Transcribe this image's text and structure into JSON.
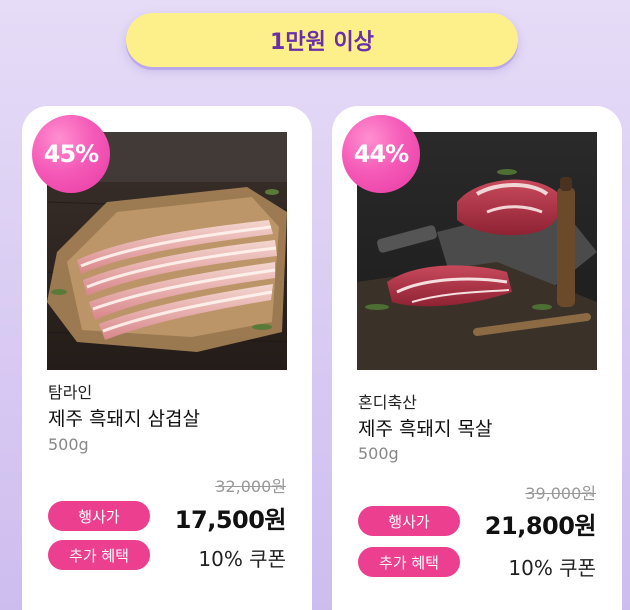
{
  "section": {
    "title": "1만원 이상"
  },
  "products": [
    {
      "discount": "45%",
      "brand": "탐라인",
      "name": "제주 흑돼지 삼겹살",
      "weight": "500g",
      "original_price": "32,000원",
      "sale_label": "행사가",
      "sale_price": "17,500원",
      "extra_label": "추가 혜택",
      "extra_value": "10% 쿠폰",
      "image": "pork-belly-photo"
    },
    {
      "discount": "44%",
      "brand": "혼디축산",
      "name": "제주 흑돼지 목살",
      "weight": "500g",
      "original_price": "39,000원",
      "sale_label": "행사가",
      "sale_price": "21,800원",
      "extra_label": "추가 혜택",
      "extra_value": "10% 쿠폰",
      "image": "pork-neck-photo"
    }
  ],
  "colors": {
    "background": "#d7c9f2",
    "pill_yellow": "#fdf08a",
    "pill_text": "#6a2fa8",
    "badge_pink": "#f55bb8",
    "label_pink": "#ec3f8f"
  }
}
